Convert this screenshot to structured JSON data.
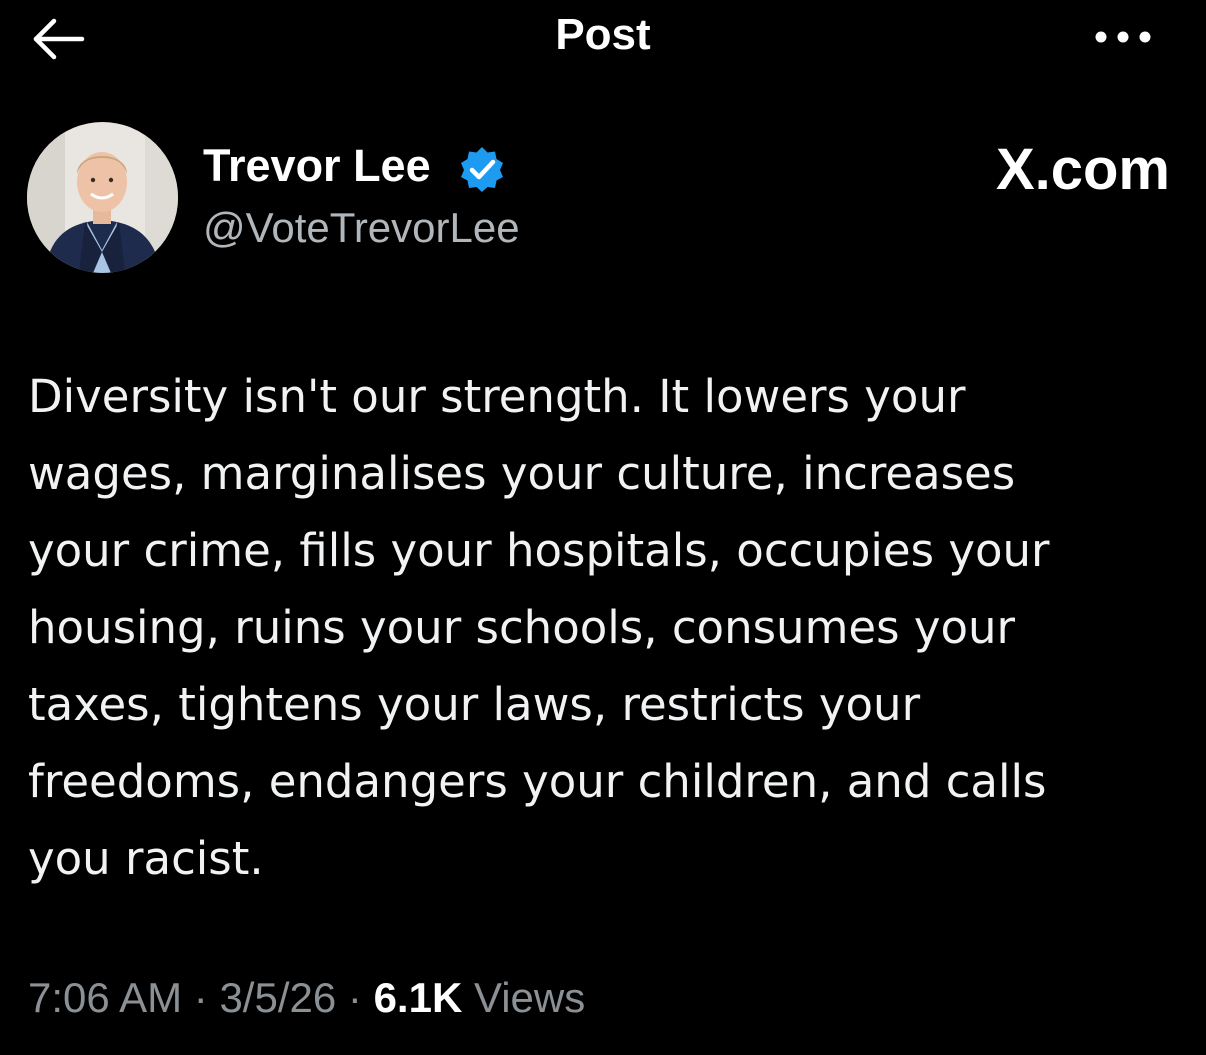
{
  "header": {
    "title": "Post",
    "back_icon": "arrow-left-icon",
    "more_icon": "more-horizontal-icon"
  },
  "author": {
    "display_name": "Trevor Lee",
    "handle": "@VoteTrevorLee",
    "verified_icon": "verified-badge-icon",
    "verified_color": "#1d9bf0"
  },
  "watermark": "X.com",
  "post": {
    "text": "Diversity isn't our strength. It lowers your\nwages, marginalises your culture, increases\nyour crime, fills your hospitals, occupies your\nhousing, ruins your schools, consumes your\ntaxes, tightens your laws, restricts your\nfreedoms, endangers your children, and calls\nyou racist."
  },
  "meta": {
    "time": "7:06 AM",
    "separator": "·",
    "date": "3/5/26",
    "views_count": "6.1K",
    "views_label": "Views"
  }
}
